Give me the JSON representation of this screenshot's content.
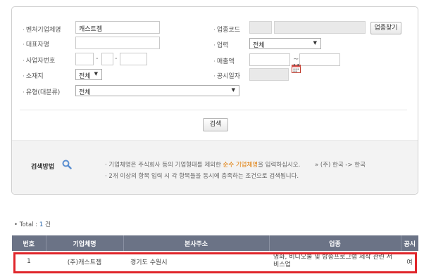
{
  "form": {
    "company_name": {
      "label": "벤처기업체명",
      "value": "캐스트젬"
    },
    "ceo": {
      "label": "대표자명",
      "value": ""
    },
    "biz_no": {
      "label": "사업자번호",
      "parts": [
        "",
        "",
        ""
      ],
      "sep": "-"
    },
    "location": {
      "label": "소재지",
      "selected": "전체"
    },
    "category": {
      "label": "유형(대분류)",
      "selected": "전체"
    },
    "industry_code": {
      "label": "업종코드",
      "button": "업종찾기"
    },
    "industry": {
      "label": "업력",
      "selected": "전체"
    },
    "sales": {
      "label": "매출액",
      "sep": "~"
    },
    "pub_date": {
      "label": "공시일자"
    },
    "search_button": "검색"
  },
  "search_method": {
    "title": "검색방법",
    "note1_pre": "· 기업체명은 주식회사 등의 기업형태를 제외한 ",
    "note1_hl": "순수 기업체명",
    "note1_post": "을 입력하십시오.",
    "note1_example": "» (주) 한국 -> 한국",
    "note2": "· 2개 이상의 항목 입력 시 각 항목들을 동시에 충족하는 조건으로 검색됩니다."
  },
  "results": {
    "total_label": "• Total :",
    "total_count": "1",
    "total_unit": "건",
    "headers": [
      "번호",
      "기업체명",
      "본사주소",
      "업종",
      "공시"
    ],
    "rows": [
      {
        "no": "1",
        "name": "(주)캐스트젬",
        "address": "경기도 수원시",
        "industry": "영화, 비디오물 및 방송프로그램 제작 관련 서비스업",
        "pub": "여"
      }
    ]
  },
  "colors": {
    "table_header": "#6b7386",
    "highlight": "#e0262b",
    "accent": "#e07a00"
  }
}
